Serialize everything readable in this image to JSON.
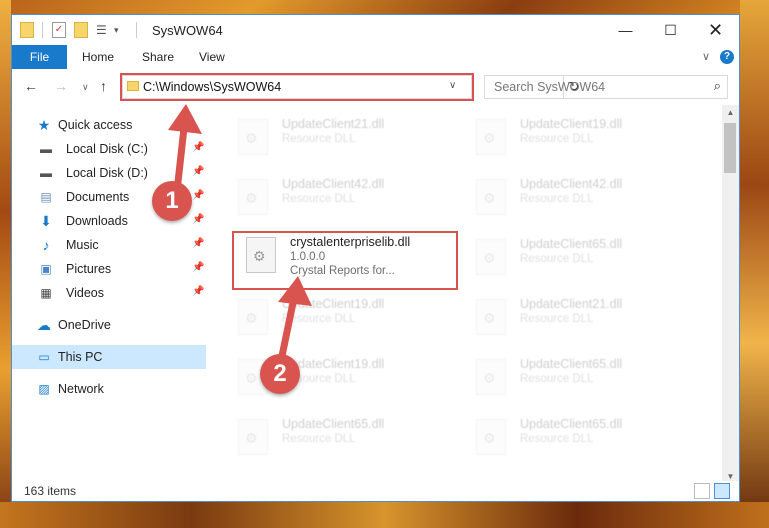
{
  "window": {
    "title": "SysWOW64"
  },
  "ribbon": {
    "file": "File",
    "tabs": [
      "Home",
      "Share",
      "View"
    ]
  },
  "address": {
    "path": "C:\\Windows\\SysWOW64",
    "search_placeholder": "Search SysWOW64"
  },
  "nav": {
    "quick_access": "Quick access",
    "items": [
      {
        "label": "Local Disk (C:)",
        "icon": "drive-icon"
      },
      {
        "label": "Local Disk (D:)",
        "icon": "drive-icon"
      },
      {
        "label": "Documents",
        "icon": "documents-icon"
      },
      {
        "label": "Downloads",
        "icon": "downloads-icon"
      },
      {
        "label": "Music",
        "icon": "music-icon"
      },
      {
        "label": "Pictures",
        "icon": "pictures-icon"
      },
      {
        "label": "Videos",
        "icon": "videos-icon"
      }
    ],
    "onedrive": "OneDrive",
    "this_pc": "This PC",
    "network": "Network"
  },
  "files": [
    {
      "name": "UpdateClient21.dll",
      "desc": "Resource DLL"
    },
    {
      "name": "UpdateClient19.dll",
      "desc": "Resource DLL"
    },
    {
      "name": "UpdateClient42.dll",
      "desc": "Resource DLL"
    },
    {
      "name": "UpdateClient42.dll",
      "desc": "Resource DLL"
    },
    {
      "name": "crystalenterpriselib.dll",
      "version": "1.0.0.0",
      "desc": "Crystal Reports for..."
    },
    {
      "name": "UpdateClient65.dll",
      "desc": "Resource DLL"
    },
    {
      "name": "UpdateClient19.dll",
      "desc": "Resource DLL"
    },
    {
      "name": "UpdateClient21.dll",
      "desc": "Resource DLL"
    },
    {
      "name": "UpdateClient19.dll",
      "desc": "Resource DLL"
    },
    {
      "name": "UpdateClient65.dll",
      "desc": "Resource DLL"
    },
    {
      "name": "UpdateClient65.dll",
      "desc": "Resource DLL"
    },
    {
      "name": "UpdateClient65.dll",
      "desc": "Resource DLL"
    }
  ],
  "status": {
    "items": "163 items"
  },
  "callouts": [
    "1",
    "2"
  ],
  "colors": {
    "accent": "#1979ca",
    "highlight": "#d9534f",
    "selected": "#cce8ff"
  }
}
